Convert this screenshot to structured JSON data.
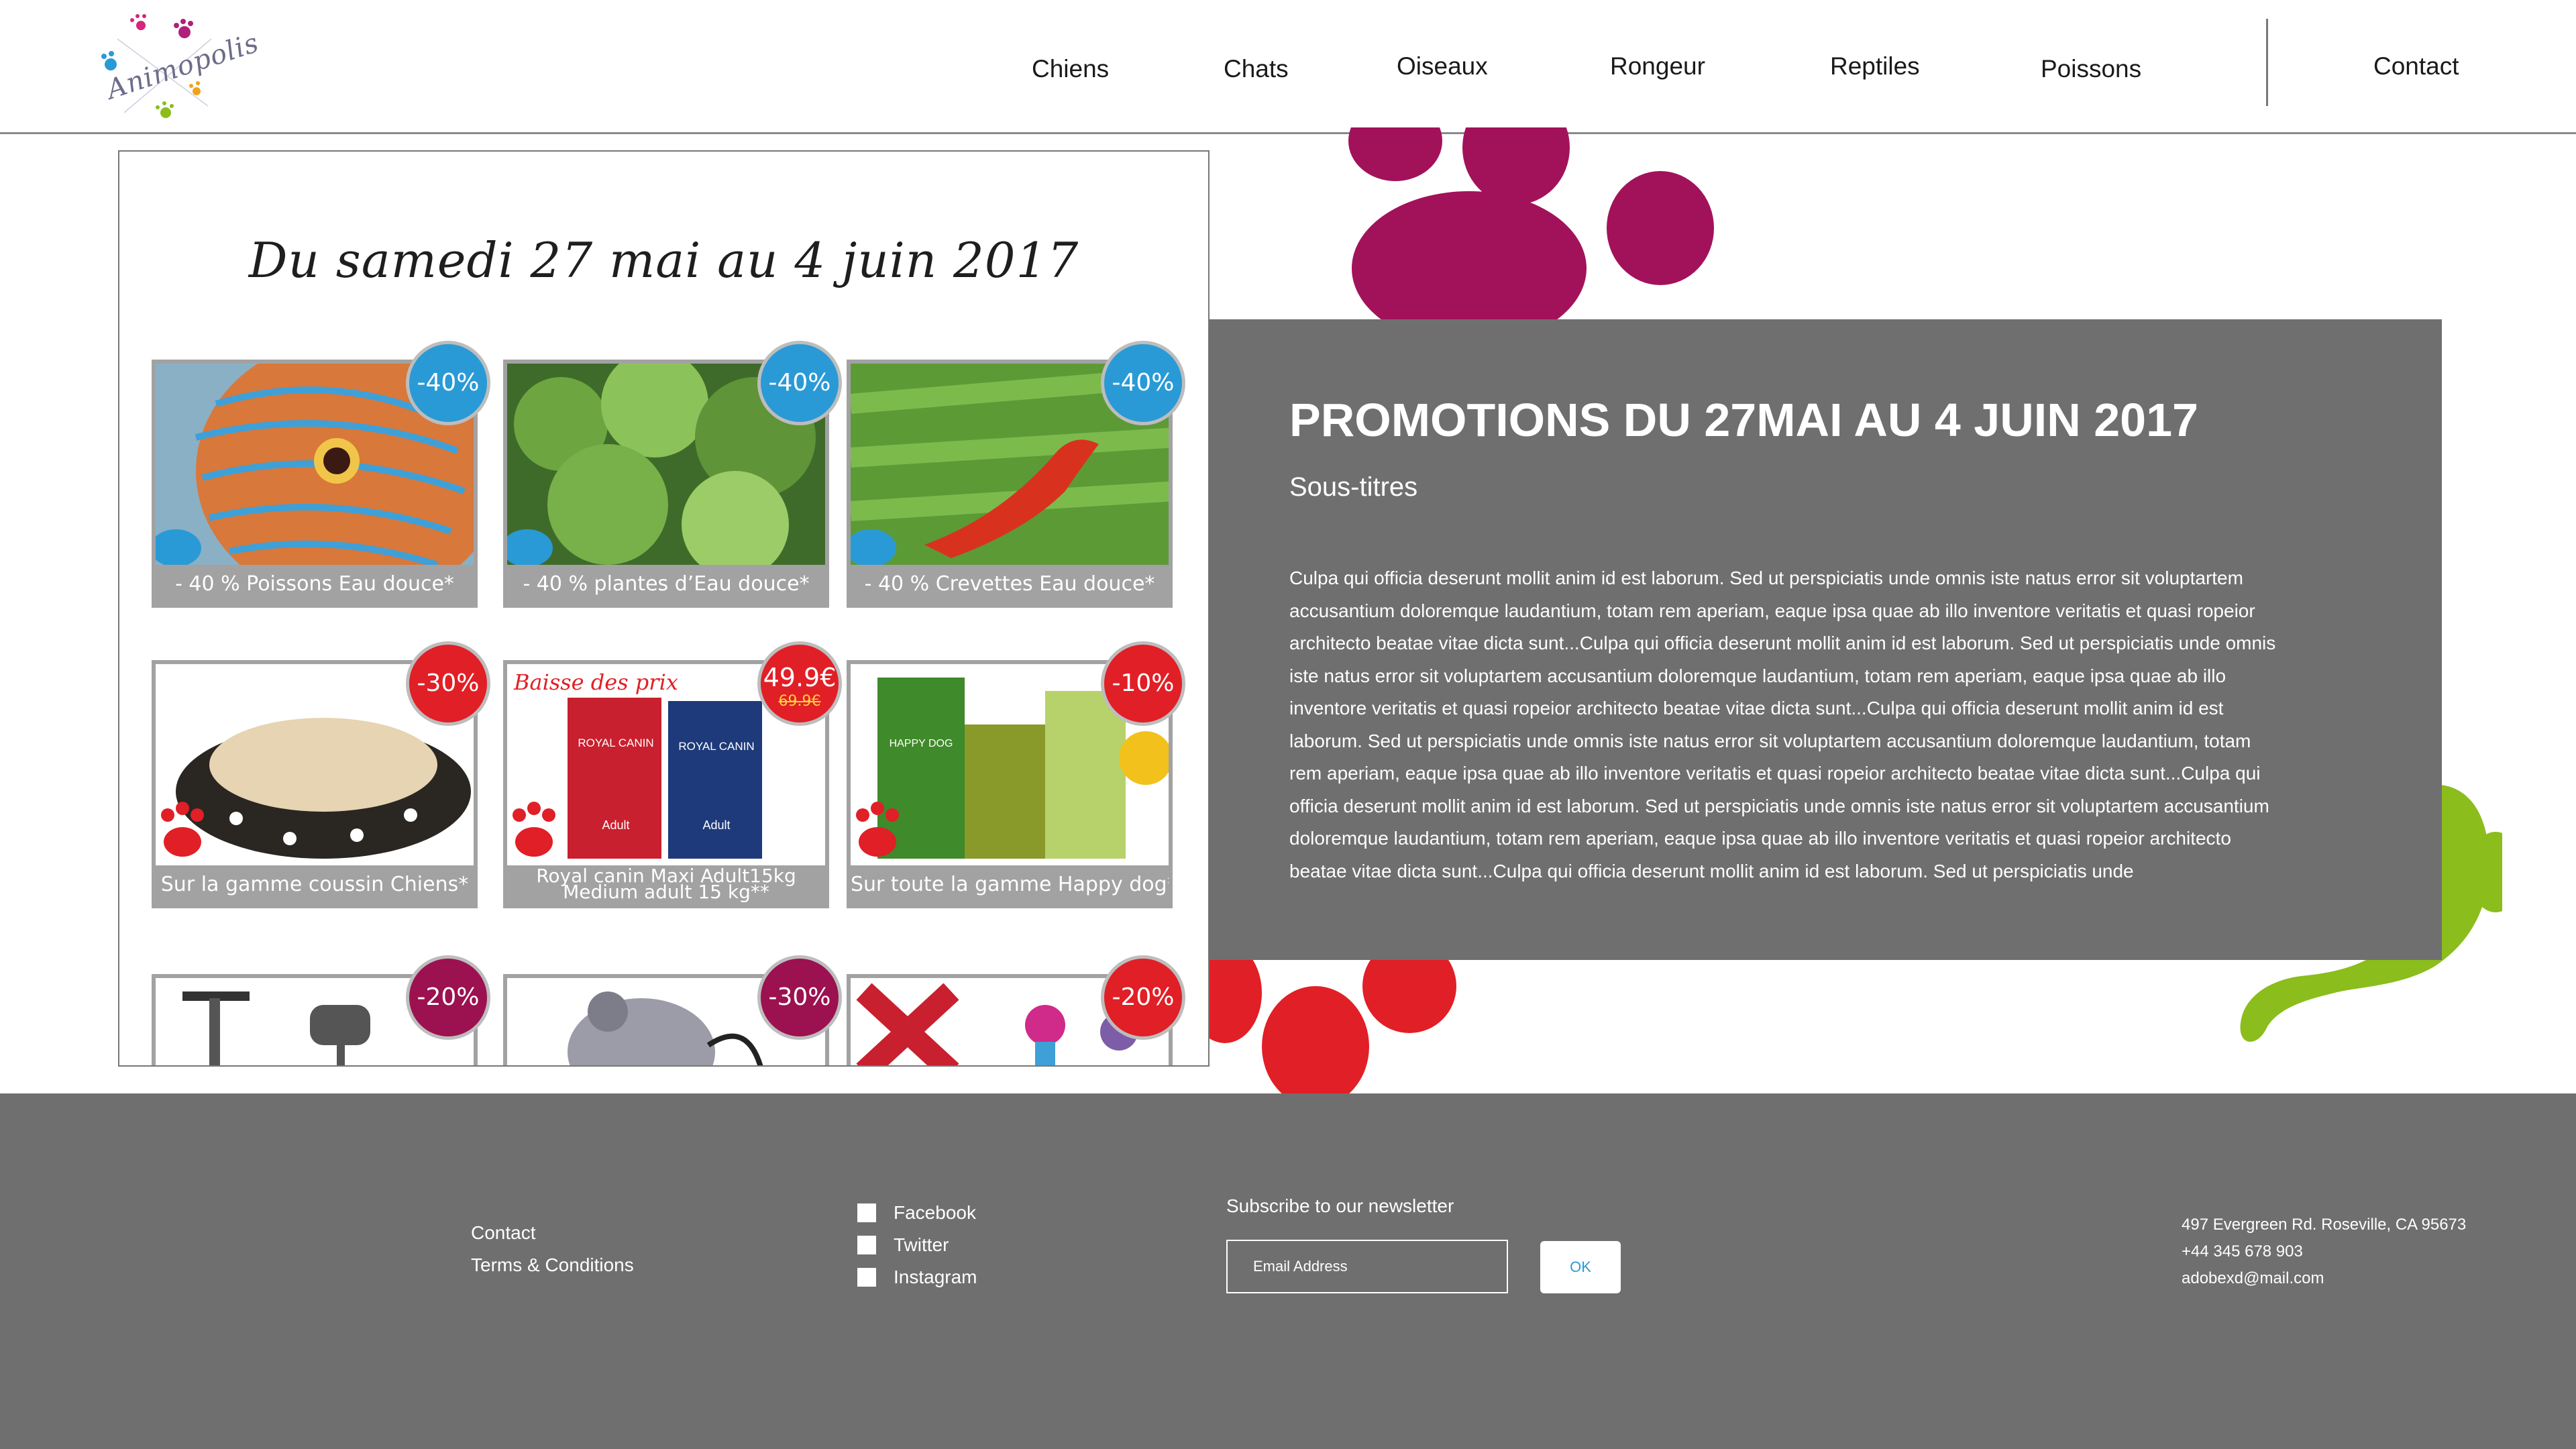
{
  "header": {
    "logo_text": "Animopolis",
    "nav": [
      {
        "label": "Chiens"
      },
      {
        "label": "Chats"
      },
      {
        "label": "Oiseaux"
      },
      {
        "label": "Rongeur"
      },
      {
        "label": "Reptiles"
      },
      {
        "label": "Poissons"
      }
    ],
    "contact_label": "Contact"
  },
  "flyer": {
    "title": "Du samedi 27 mai au 4 juin 2017",
    "cards": [
      {
        "caption": "- 40 %  Poissons Eau douce*",
        "badge": "-40%"
      },
      {
        "caption": "- 40 %  plantes d’Eau douce*",
        "badge": "-40%"
      },
      {
        "caption": "- 40 %  Crevettes Eau douce*",
        "badge": "-40%"
      },
      {
        "caption": "Sur la gamme coussin Chiens*",
        "badge": "-30%"
      },
      {
        "caption_line1": "Royal canin Maxi Adult15kg",
        "caption_line2": "Medium adult 15 kg**",
        "badge": "49.9€",
        "old_price": "69.9€",
        "banner": "Baisse des prix",
        "brand": "ROYAL CANIN",
        "pack_label": "Adult"
      },
      {
        "caption": "Sur toute la gamme Happy dog*",
        "badge": "-10%",
        "brand": "HAPPY DOG"
      },
      {
        "badge": "-20%"
      },
      {
        "badge": "-30%"
      },
      {
        "badge": "-20%"
      }
    ]
  },
  "promo": {
    "title": "PROMOTIONS DU 27MAI AU 4 JUIN 2017",
    "subtitle": "Sous-titres",
    "body": "Culpa qui officia deserunt mollit anim id est laborum. Sed ut perspiciatis unde omnis iste natus error sit voluptartem accusantium doloremque laudantium, totam rem aperiam, eaque ipsa quae ab illo inventore veritatis et quasi ropeior architecto beatae vitae dicta sunt...Culpa qui officia deserunt mollit anim id est laborum. Sed ut perspiciatis unde omnis iste natus error sit voluptartem accusantium doloremque laudantium, totam rem aperiam, eaque ipsa quae ab illo inventore veritatis et quasi ropeior architecto beatae vitae dicta sunt...Culpa qui officia deserunt mollit anim id est laborum. Sed ut perspiciatis unde omnis iste natus error sit voluptartem accusantium doloremque laudantium, totam rem aperiam, eaque ipsa quae ab illo inventore veritatis et quasi ropeior architecto beatae vitae dicta sunt...Culpa qui officia deserunt mollit anim id est laborum. Sed ut perspiciatis unde omnis iste natus error sit voluptartem accusantium doloremque laudantium, totam rem aperiam, eaque ipsa quae ab illo inventore veritatis et quasi ropeior architecto beatae vitae dicta sunt...Culpa qui officia deserunt mollit anim id est laborum. Sed ut perspiciatis unde"
  },
  "footer": {
    "links": [
      "Contact",
      "Terms & Conditions"
    ],
    "social": [
      "Facebook",
      "Twitter",
      "Instagram"
    ],
    "newsletter_label": "Subscribe to our newsletter",
    "email_placeholder": "Email Address",
    "ok_label": "OK",
    "address": "497 Evergreen Rd. Roseville, CA 95673",
    "phone": "+44 345 678 903",
    "email": "adobexd@mail.com"
  },
  "colors": {
    "gray_panel": "#6f6f6f",
    "paw_plum": "#a2125a",
    "paw_red": "#e11f26",
    "paw_green": "#8bbd1c",
    "badge_blue": "#2a9ad6"
  }
}
